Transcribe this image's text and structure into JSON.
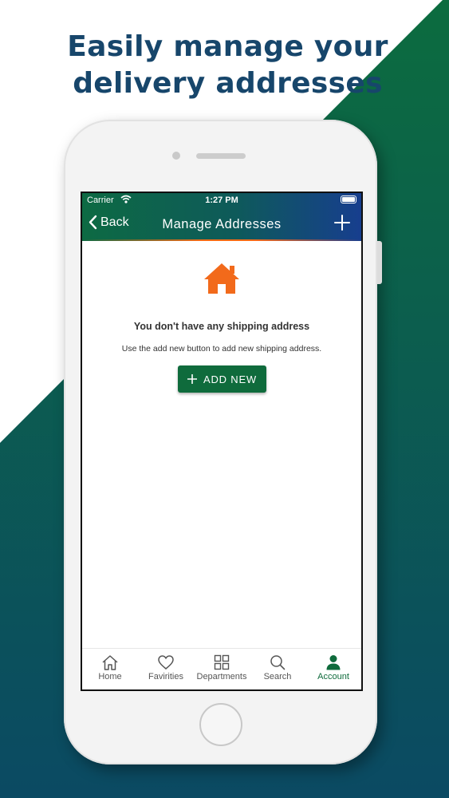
{
  "headline": {
    "line1": "Easily manage your",
    "line2": "delivery addresses"
  },
  "colors": {
    "brand_green": "#0f6b3c",
    "headline": "#17466b",
    "accent_orange": "#ff6a13",
    "gradient_blue": "#173e8e"
  },
  "status_bar": {
    "carrier": "Carrier",
    "time": "1:27 PM"
  },
  "navbar": {
    "back_label": "Back",
    "title": "Manage Addresses",
    "add_icon": "plus-icon"
  },
  "empty_state": {
    "icon": "home-icon",
    "title": "You don't have any shipping address",
    "subtitle": "Use the add new button to add new shipping address.",
    "button_label": "ADD NEW"
  },
  "tabbar": {
    "items": [
      {
        "label": "Home",
        "icon": "home-outline-icon"
      },
      {
        "label": "Favirities",
        "icon": "heart-icon"
      },
      {
        "label": "Departments",
        "icon": "grid-icon"
      },
      {
        "label": "Search",
        "icon": "search-icon"
      },
      {
        "label": "Account",
        "icon": "person-icon",
        "active": true
      }
    ]
  }
}
